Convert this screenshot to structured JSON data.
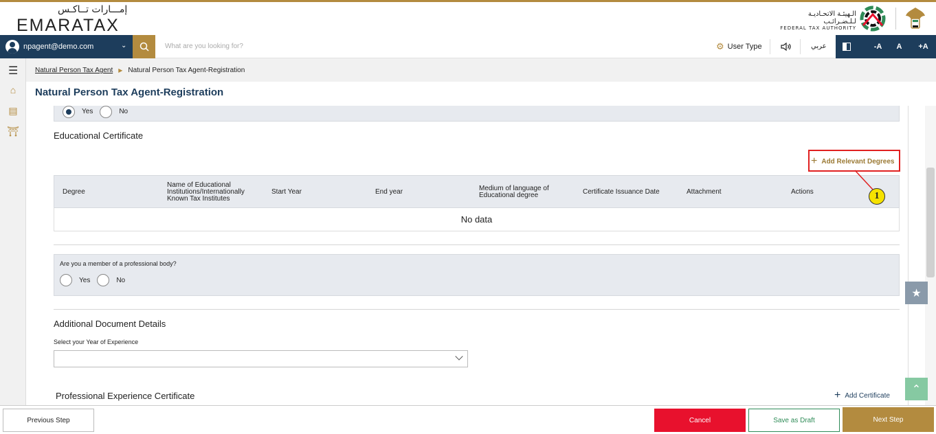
{
  "header": {
    "logo_ar": "إمـــارات تــاكـس",
    "logo_en": "EMARATAX",
    "fta_ar": "الـهيئـة الاتحـاديـة لـلـضـرائـب",
    "fta_en": "FEDERAL TAX AUTHORITY"
  },
  "navbar": {
    "user_email": "npagent@demo.com",
    "search_placeholder": "What are you looking for?",
    "user_type": "User Type",
    "language": "عربي",
    "font_decrease": "-A",
    "font_normal": "A",
    "font_increase": "+A"
  },
  "breadcrumb": {
    "parent": "Natural Person Tax Agent",
    "current": "Natural Person Tax Agent-Registration"
  },
  "page_title": "Natural Person Tax Agent-Registration",
  "top_radio": {
    "yes": "Yes",
    "no": "No",
    "selected": "Yes"
  },
  "educational": {
    "title": "Educational Certificate",
    "add_label": "Add Relevant Degrees",
    "columns": [
      "Degree",
      "Name of Educational Institutions/Internationally Known Tax Institutes",
      "Start Year",
      "End year",
      "Medium of language of Educational degree",
      "Certificate Issuance Date",
      "Attachment",
      "Actions"
    ],
    "empty_text": "No data"
  },
  "professional_body": {
    "question": "Are you a member of a professional body?",
    "yes": "Yes",
    "no": "No"
  },
  "additional_docs": {
    "title": "Additional Document Details",
    "experience_label": "Select your Year of Experience",
    "experience_value": ""
  },
  "professional_experience": {
    "title": "Professional Experience Certificate",
    "add_label": "Add Certificate"
  },
  "annotation_number": "1",
  "footer": {
    "previous": "Previous Step",
    "cancel": "Cancel",
    "save_draft": "Save as Draft",
    "next": "Next Step"
  },
  "colors": {
    "navy": "#1d3d5c",
    "gold": "#b38b3f",
    "cancel_red": "#e8112d",
    "draft_green": "#2e8b57",
    "annotation_yellow": "#f6e200"
  }
}
